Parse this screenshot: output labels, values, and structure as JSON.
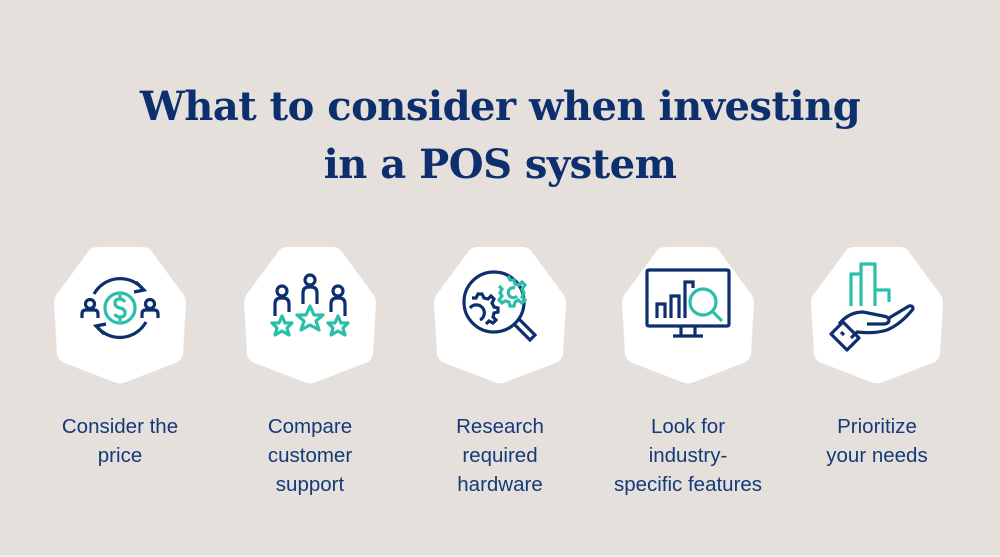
{
  "title": {
    "line1": "What to consider when investing",
    "line2": "in a POS system"
  },
  "colors": {
    "background": "#e5e0dc",
    "navy": "#0d2f6e",
    "teal": "#2bbfa9",
    "badge": "#ffffff"
  },
  "items": [
    {
      "icon": "price-exchange-icon",
      "label_lines": [
        "Consider the",
        "price"
      ]
    },
    {
      "icon": "customer-rating-icon",
      "label_lines": [
        "Compare",
        "customer",
        "support"
      ]
    },
    {
      "icon": "hardware-research-icon",
      "label_lines": [
        "Research",
        "required",
        "hardware"
      ]
    },
    {
      "icon": "analytics-search-icon",
      "label_lines": [
        "Look for",
        "industry-",
        "specific features"
      ]
    },
    {
      "icon": "hand-growth-icon",
      "label_lines": [
        "Prioritize",
        "your needs"
      ]
    }
  ]
}
